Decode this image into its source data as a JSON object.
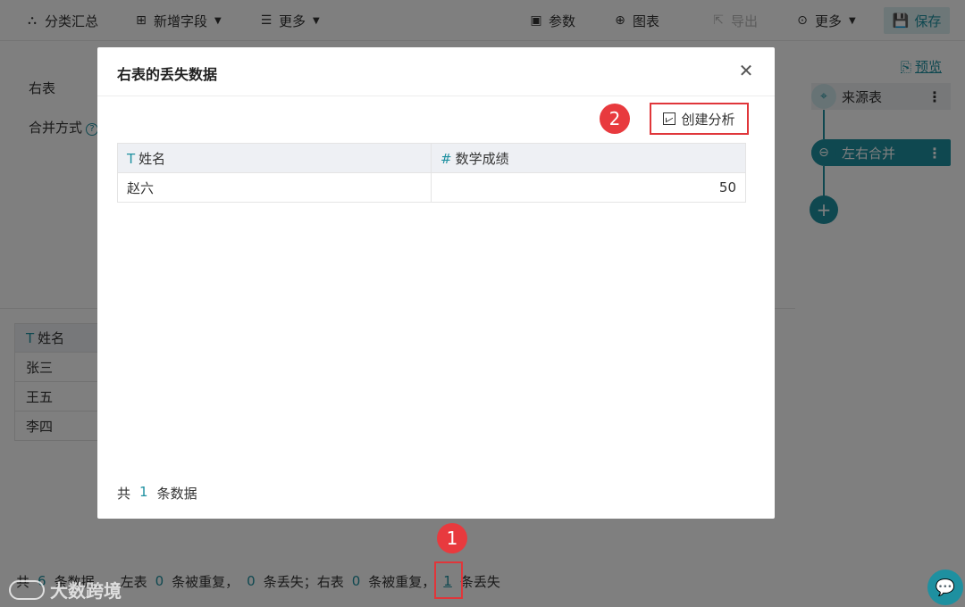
{
  "toolbar": {
    "group_summary": "分类汇总",
    "add_field": "新增字段",
    "more_left": "更多",
    "params": "参数",
    "chart": "图表",
    "export": "导出",
    "more_right": "更多",
    "save": "保存"
  },
  "config": {
    "right_table_label": "右表",
    "merge_mode_label": "合并方式",
    "help_glyph": "?"
  },
  "left_table": {
    "header": "姓名",
    "rows": [
      "张三",
      "王五",
      "李四"
    ]
  },
  "status": {
    "prefix": "共",
    "total": "6",
    "rows_text": "条数据，",
    "left_label": "左表",
    "left_dup_count": "0",
    "dup_text": "条被重复，",
    "left_lost_count": "0",
    "lost_text_sep": "条丢失；右表",
    "right_dup_count": "0",
    "right_dup_text": "条被重复，",
    "right_lost_count": "1",
    "right_lost_text": "条丢失"
  },
  "watermark": "大数跨境",
  "flow": {
    "preview": "预览",
    "source_node": "来源表",
    "merge_node": "左右合并",
    "add_glyph": "+"
  },
  "modal": {
    "title": "右表的丢失数据",
    "create_analysis": "创建分析",
    "columns": [
      {
        "type_glyph": "T",
        "label": "姓名"
      },
      {
        "type_glyph": "#",
        "label": "数学成绩"
      }
    ],
    "rows": [
      {
        "name": "赵六",
        "score": "50"
      }
    ],
    "footer_prefix": "共",
    "footer_count": "1",
    "footer_suffix": "条数据"
  },
  "badges": {
    "step1": "1",
    "step2": "2"
  },
  "colors": {
    "accent": "#1e90a0",
    "highlight": "#e0363a"
  }
}
